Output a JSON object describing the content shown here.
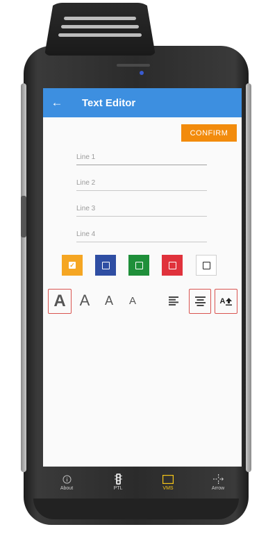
{
  "appbar": {
    "back_icon": "←",
    "title": "Text Editor"
  },
  "confirm_label": "CONFIRM",
  "lines": [
    {
      "placeholder": "Line 1"
    },
    {
      "placeholder": "Line 2"
    },
    {
      "placeholder": "Line 3"
    },
    {
      "placeholder": "Line 4"
    }
  ],
  "colors": {
    "appbar": "#3d8fe0",
    "confirm": "#f28b0c",
    "swatches": [
      "#f5a623",
      "#2f4ea3",
      "#1f8f3a",
      "#e0323c",
      "#ffffff"
    ],
    "selected_outline": "#d9534f",
    "nav_active": "#f5c518"
  },
  "selected_color_index": 0,
  "font_size_letter": "A",
  "align_icons": [
    "align-left-icon",
    "align-center-icon",
    "font-size-up-icon"
  ],
  "font_up_label": "A",
  "nav": [
    {
      "label": "About",
      "icon": "info-icon"
    },
    {
      "label": "PTL",
      "icon": "ptl-icon"
    },
    {
      "label": "VMS",
      "icon": "vms-icon"
    },
    {
      "label": "Arrow",
      "icon": "arrow-icon"
    }
  ],
  "nav_active_index": 2
}
